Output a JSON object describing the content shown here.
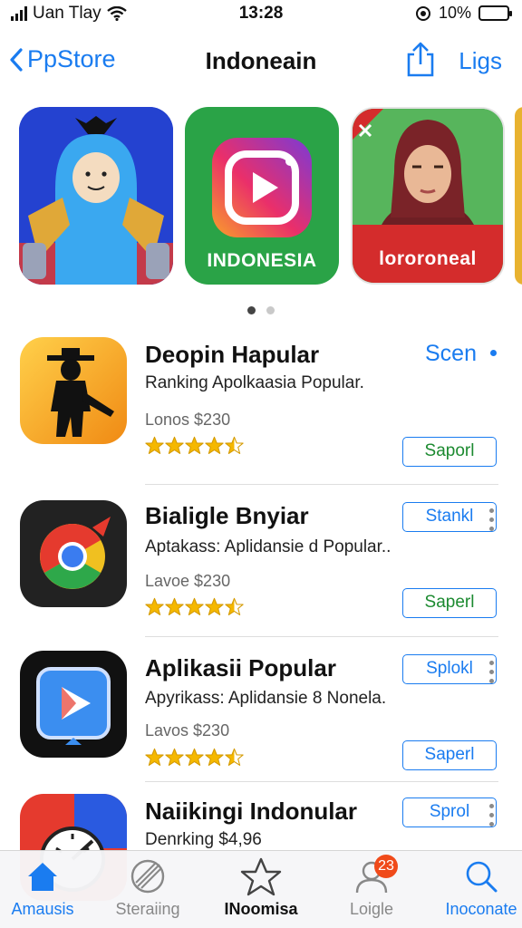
{
  "status_bar": {
    "carrier": "Uan Tlay",
    "time": "13:28",
    "battery": "10%",
    "battery_level": 0.3
  },
  "nav": {
    "back_label": "PpStore",
    "title": "Indoneain",
    "right_label": "Ligs"
  },
  "featured": [
    {
      "caption": "",
      "icon": "game-character-icon"
    },
    {
      "caption": "INDONESIA",
      "icon": "instagram-style-icon"
    },
    {
      "caption": "lororoneal",
      "icon": "portrait-icon"
    }
  ],
  "carousel": {
    "page_count": 2,
    "active_page": 1
  },
  "section": {
    "see_all_label": "Scen"
  },
  "apps": [
    {
      "name": "Deopin Hapular",
      "subtitle": "Ranking Apolkaasia Popular.",
      "price": "Lonos  $230",
      "rating": 4.5,
      "button": "Saporl",
      "button_style": "green",
      "top_button": ""
    },
    {
      "name": "Bialigle Bnyiar",
      "subtitle": "Aptakass: Aplidansie d Popular..",
      "price": "Lavoe  $230",
      "rating": 4.5,
      "button": "Saperl",
      "button_style": "green",
      "top_button": "Stankl"
    },
    {
      "name": "Aplikasii Popular",
      "subtitle": "Apyrikass: Aplidansie 8 Nonela.",
      "price": "Lavos  $230",
      "rating": 4.5,
      "button": "Saperl",
      "button_style": "blue",
      "top_button": "Splokl"
    },
    {
      "name": "Naiikingi Indonular",
      "subtitle": "Denrking  $4,96",
      "price": "",
      "rating": 0,
      "button": "",
      "button_style": "blue",
      "top_button": "Sprol"
    }
  ],
  "tabs": [
    {
      "label": "Amausis",
      "icon": "home-icon"
    },
    {
      "label": "Steraiing",
      "icon": "rocket-icon"
    },
    {
      "label": "INoomisa",
      "icon": "star-icon"
    },
    {
      "label": "Loigle",
      "icon": "person-icon",
      "badge": "23"
    },
    {
      "label": "Inoconate",
      "icon": "search-icon"
    }
  ],
  "colors": {
    "accent": "#1a7cf0",
    "star": "#f5b800",
    "badge": "#f04a1a"
  }
}
